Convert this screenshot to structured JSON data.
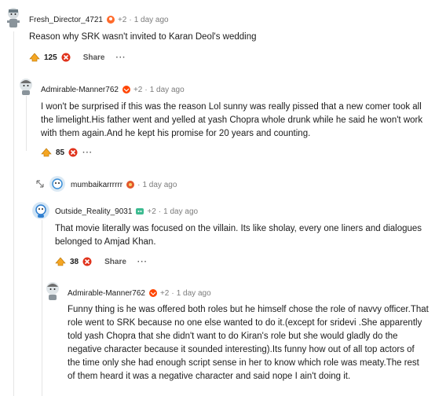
{
  "comments": [
    {
      "username": "Fresh_Director_4721",
      "plus": "+2",
      "time": "1 day ago",
      "body": "Reason why SRK wasn't invited to Karan Deol's wedding",
      "score": "125",
      "share": "Share",
      "more": "···"
    },
    {
      "username": "Admirable-Manner762",
      "plus": "+2",
      "time": "1 day ago",
      "body": "I won't be surprised if this was the reason Lol sunny was really pissed that a new comer took all the limelight.His father went and yelled at yash Chopra whole drunk while he said he won't work with them again.And he kept his promise for 20 years and counting.",
      "score": "85",
      "more": "···"
    },
    {
      "username": "mumbaikarrrrrr",
      "time": "1 day ago"
    },
    {
      "username": "Outside_Reality_9031",
      "plus": "+2",
      "time": "1 day ago",
      "body": "That movie literally was focused on the villain. Its like sholay, every one liners and dialogues belonged to Amjad Khan.",
      "score": "38",
      "share": "Share",
      "more": "···"
    },
    {
      "username": "Admirable-Manner762",
      "plus": "+2",
      "time": "1 day ago",
      "body": "Funny thing is he was offered both roles but he himself chose the role of navvy officer.That role went to SRK because no one else wanted to do it.(except for sridevi .She apparently told yash Chopra that she didn't want to do Kiran's role but she would gladly do the negative character because it sounded interesting).Its funny how out of all top actors of the time only she had enough script sense in her to know which role was meaty.The rest of them heard it was a negative character and said nope I ain't doing it."
    }
  ],
  "separator": "·",
  "colors": {
    "upvote": "#f5a623",
    "downvote": "#e0321b",
    "meta": "#7c7c7c"
  }
}
